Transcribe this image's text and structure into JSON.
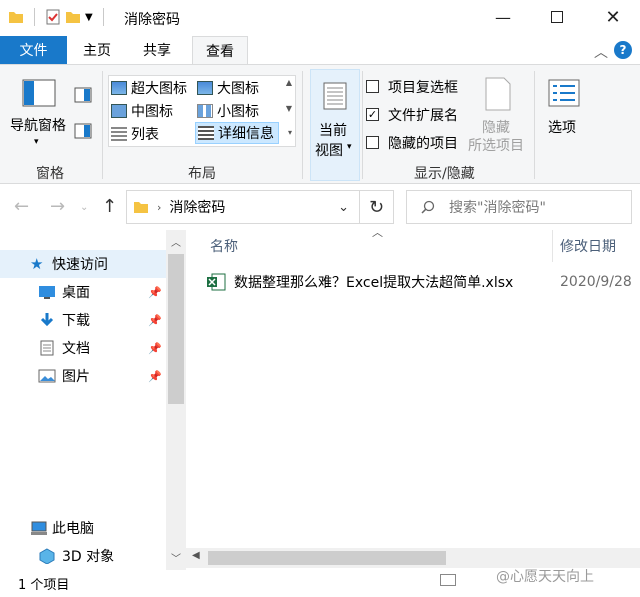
{
  "window": {
    "title": "消除密码",
    "minimize_icon": "minimize-icon",
    "maximize_icon": "maximize-icon",
    "close_icon": "close-icon"
  },
  "ribbon_tabs": [
    {
      "label": "文件"
    },
    {
      "label": "主页"
    },
    {
      "label": "共享"
    },
    {
      "label": "查看"
    }
  ],
  "ribbon": {
    "pane_group": {
      "nav_pane_label": "导航窗格",
      "group_label": "窗格"
    },
    "layout_group": {
      "items": [
        {
          "label": "超大图标"
        },
        {
          "label": "大图标"
        },
        {
          "label": "中图标"
        },
        {
          "label": "小图标"
        },
        {
          "label": "列表"
        },
        {
          "label": "详细信息"
        }
      ],
      "group_label": "布局"
    },
    "current_view": {
      "line1": "当前",
      "line2": "视图"
    },
    "show_hide": {
      "item_checkboxes": "项目复选框",
      "item_checkboxes_checked": false,
      "file_extensions": "文件扩展名",
      "file_extensions_checked": true,
      "hidden_items": "隐藏的项目",
      "hidden_items_checked": false,
      "hide_selected_line1": "隐藏",
      "hide_selected_line2": "所选项目",
      "group_label": "显示/隐藏"
    },
    "options_label": "选项"
  },
  "address_bar": {
    "path": "消除密码",
    "search_placeholder": "搜索\"消除密码\""
  },
  "nav_pane": {
    "items": [
      {
        "label": "快速访问",
        "icon": "star-icon"
      },
      {
        "label": "桌面",
        "icon": "desktop-icon"
      },
      {
        "label": "下载",
        "icon": "download-icon"
      },
      {
        "label": "文档",
        "icon": "document-icon"
      },
      {
        "label": "图片",
        "icon": "picture-icon"
      },
      {
        "label": "此电脑",
        "icon": "computer-icon"
      },
      {
        "label": "3D 对象",
        "icon": "3d-objects-icon"
      }
    ]
  },
  "file_list": {
    "columns": [
      "名称",
      "修改日期"
    ],
    "rows": [
      {
        "name": "数据整理那么难？Excel提取大法超简单.xlsx",
        "modified": "2020/9/28"
      }
    ]
  },
  "status": {
    "item_count": "1 个项目"
  },
  "watermark": "@心愿天天向上",
  "colors": {
    "file_tab": "#1979ca",
    "selection": "#cce8ff",
    "excel_green": "#1d6f42",
    "folder_yellow": "#f5c342"
  }
}
